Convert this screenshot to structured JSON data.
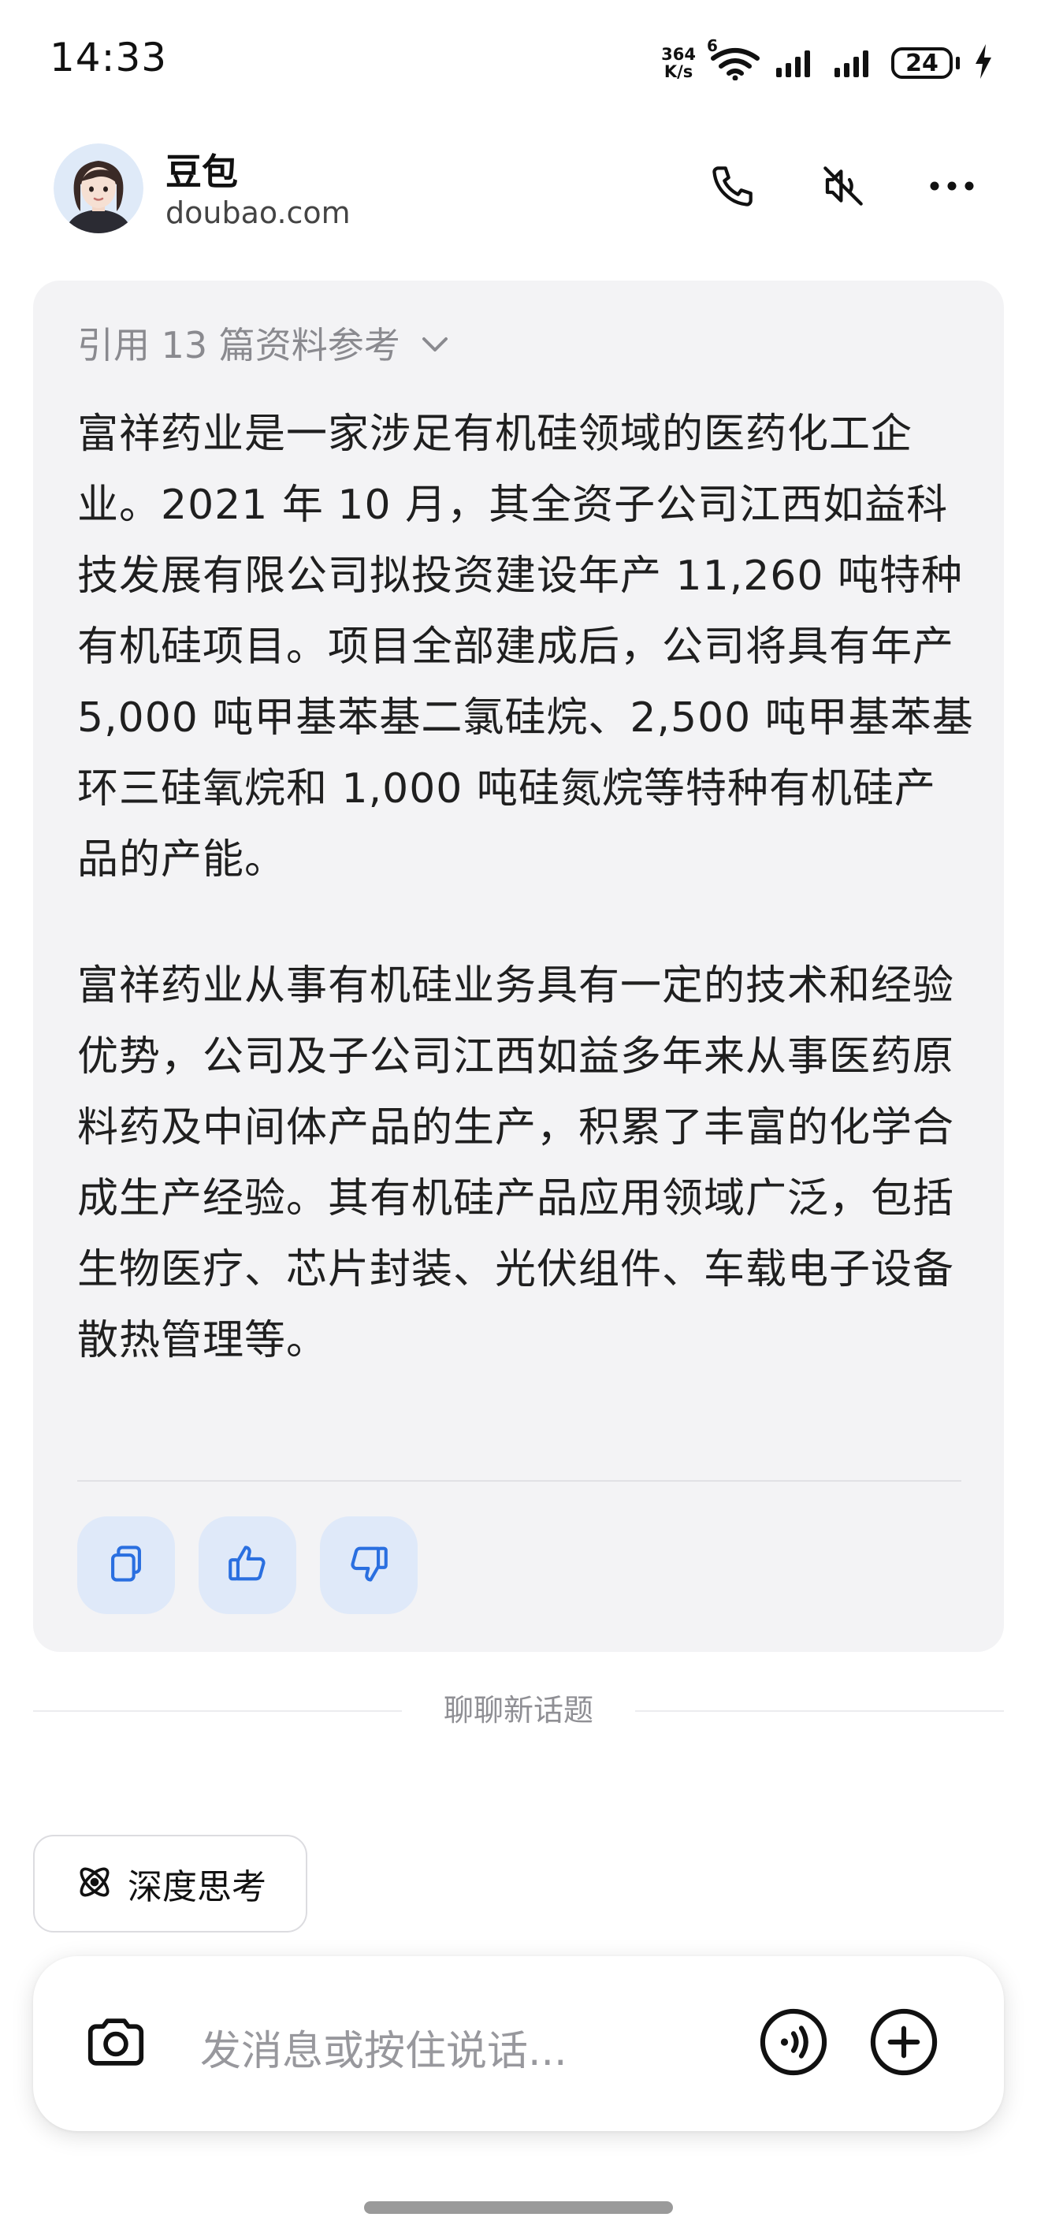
{
  "status_bar": {
    "time": "14:33",
    "net_speed_value": "364",
    "net_speed_unit": "K/s",
    "wifi_badge": "6",
    "battery": "24",
    "icons": [
      "wifi-icon",
      "signal-icon",
      "signal-icon",
      "battery-icon",
      "charging-icon"
    ]
  },
  "header": {
    "bot_name": "豆包",
    "bot_domain": "doubao.com",
    "icons": [
      "phone-icon",
      "mute-icon",
      "more-icon"
    ]
  },
  "message": {
    "references_label": "引用 13 篇资料参考",
    "paragraphs": [
      "富祥药业是一家涉足有机硅领域的医药化工企业。2021 年 10 月，其全资子公司江西如益科技发展有限公司拟投资建设年产 11,260 吨特种有机硅项目。项目全部建成后，公司将具有年产 5,000 吨甲基苯基二氯硅烷、2,500 吨甲基苯基环三硅氧烷和 1,000 吨硅氮烷等特种有机硅产品的产能。",
      "富祥药业从事有机硅业务具有一定的技术和经验优势，公司及子公司江西如益多年来从事医药原料药及中间体产品的生产，积累了丰富的化学合成生产经验。其有机硅产品应用领域广泛，包括生物医疗、芯片封装、光伏组件、车载电子设备散热管理等。"
    ],
    "actions": [
      "copy-icon",
      "thumbs-up-icon",
      "thumbs-down-icon"
    ]
  },
  "new_topic_label": "聊聊新话题",
  "deep_think_label": "深度思考",
  "input": {
    "placeholder": "发消息或按住说话..."
  },
  "colors": {
    "card_background": "#f3f3f5",
    "action_button_background": "#dfe9f9",
    "action_icon": "#2a6fe0"
  }
}
